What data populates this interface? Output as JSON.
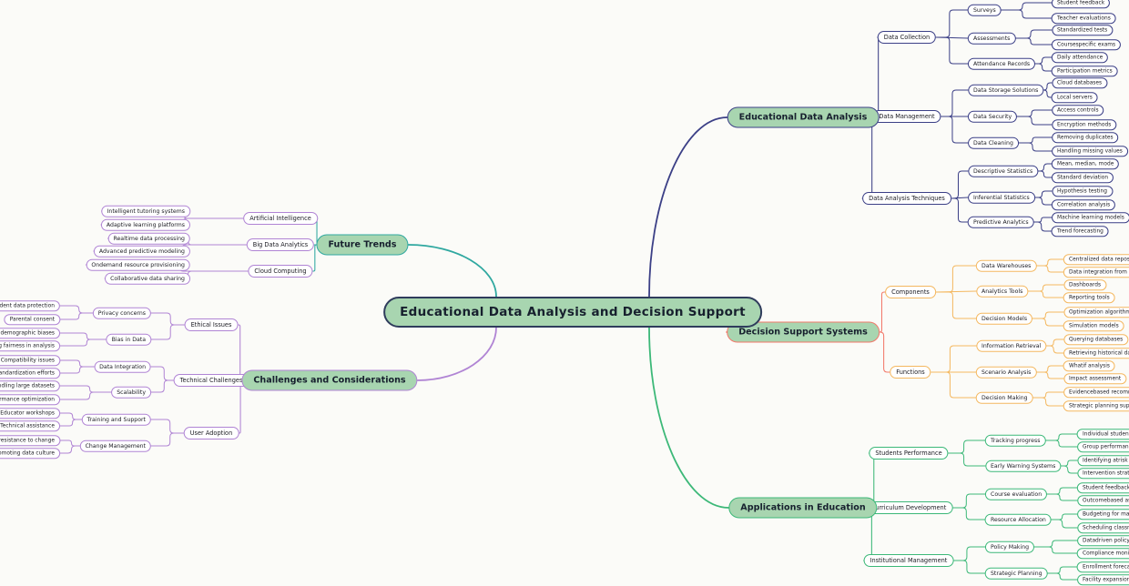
{
  "title": "Educational Data Analysis and Decision Support",
  "root": {
    "label": "Educational Data Analysis and Decision Support",
    "fill": "#a8d5b0",
    "stroke": "#2f3c5c"
  },
  "palette": {
    "background": "#fbfbf8",
    "navy": "#3b3f86",
    "teal": "#2fa8a0",
    "purple": "#b084d4",
    "coral": "#f2786a",
    "green": "#3cb878",
    "orange": "#f4b860",
    "level1_fill": "#a8d5b0"
  },
  "branches": [
    {
      "id": "educational-data-analysis",
      "label": "Educational Data Analysis",
      "color": "#3b3f86",
      "side": "right",
      "children": [
        {
          "label": "Data Collection",
          "children": [
            {
              "label": "Surveys",
              "children": [
                "Student feedback",
                "Teacher evaluations"
              ]
            },
            {
              "label": "Assessments",
              "children": [
                "Standardized tests",
                "Coursespecific exams"
              ]
            },
            {
              "label": "Attendance Records",
              "children": [
                "Daily attendance",
                "Participation metrics"
              ]
            }
          ]
        },
        {
          "label": "Data Management",
          "children": [
            {
              "label": "Data Storage Solutions",
              "children": [
                "Cloud databases",
                "Local servers"
              ]
            },
            {
              "label": "Data Security",
              "children": [
                "Access controls",
                "Encryption methods"
              ]
            },
            {
              "label": "Data Cleaning",
              "children": [
                "Removing duplicates",
                "Handling missing values"
              ]
            }
          ]
        },
        {
          "label": "Data Analysis Techniques",
          "children": [
            {
              "label": "Descriptive Statistics",
              "children": [
                "Mean, median, mode",
                "Standard deviation"
              ]
            },
            {
              "label": "Inferential Statistics",
              "children": [
                "Hypothesis testing",
                "Correlation analysis"
              ]
            },
            {
              "label": "Predictive Analytics",
              "children": [
                "Machine learning models",
                "Trend forecasting"
              ]
            }
          ]
        }
      ]
    },
    {
      "id": "decision-support-systems",
      "label": "Decision Support Systems",
      "color": "#f2786a",
      "subcolor": "#f4b860",
      "side": "right",
      "children": [
        {
          "label": "Components",
          "children": [
            {
              "label": "Data Warehouses",
              "children": [
                "Centralized data repository",
                "Data integration from multiple sources"
              ]
            },
            {
              "label": "Analytics Tools",
              "children": [
                "Dashboards",
                "Reporting tools"
              ]
            },
            {
              "label": "Decision Models",
              "children": [
                "Optimization algorithms",
                "Simulation models"
              ]
            }
          ]
        },
        {
          "label": "Functions",
          "children": [
            {
              "label": "Information Retrieval",
              "children": [
                "Querying databases",
                "Retrieving historical data"
              ]
            },
            {
              "label": "Scenario Analysis",
              "children": [
                "Whatif analysis",
                "Impact assessment"
              ]
            },
            {
              "label": "Decision Making",
              "children": [
                "Evidencebased recommendations",
                "Strategic planning support"
              ]
            }
          ]
        }
      ]
    },
    {
      "id": "applications-in-education",
      "label": "Applications in Education",
      "color": "#3cb878",
      "side": "right",
      "children": [
        {
          "label": "Students Performance",
          "children": [
            {
              "label": "Tracking progress",
              "children": [
                "Individual student analysis",
                "Group performance comparison"
              ]
            },
            {
              "label": "Early Warning Systems",
              "children": [
                "Identifying atrisk students",
                "Intervention strategies"
              ]
            }
          ]
        },
        {
          "label": "Curriculum Development",
          "children": [
            {
              "label": "Course evaluation",
              "children": [
                "Student feedback integration",
                "Outcomebased assessment"
              ]
            },
            {
              "label": "Resource Allocation",
              "children": [
                "Budgeting for materials",
                "Scheduling classrooms"
              ]
            }
          ]
        },
        {
          "label": "Institutional Management",
          "children": [
            {
              "label": "Policy Making",
              "children": [
                "Datadriven policy formulation",
                "Compliance monitoring"
              ]
            },
            {
              "label": "Strategic Planning",
              "children": [
                "Enrollment forecasting",
                "Facility expansion planning"
              ]
            }
          ]
        }
      ]
    },
    {
      "id": "challenges-and-considerations",
      "label": "Challenges and Considerations",
      "color": "#b084d4",
      "side": "left",
      "children": [
        {
          "label": "Ethical Issues",
          "children": [
            {
              "label": "Privacy concerns",
              "children": [
                "Student data protection",
                "Parental consent"
              ]
            },
            {
              "label": "Bias in Data",
              "children": [
                "Addressing demographic biases",
                "Ensuring fairness in analysis"
              ]
            }
          ]
        },
        {
          "label": "Technical Challenges",
          "children": [
            {
              "label": "Data Integration",
              "children": [
                "Compatibility issues",
                "Standardization efforts"
              ]
            },
            {
              "label": "Scalability",
              "children": [
                "Handling large datasets",
                "Performance optimization"
              ]
            }
          ]
        },
        {
          "label": "User Adoption",
          "children": [
            {
              "label": "Training and Support",
              "children": [
                "Educator workshops",
                "Technical assistance"
              ]
            },
            {
              "label": "Change Management",
              "children": [
                "Overcoming resistance to change",
                "Promoting data culture"
              ]
            }
          ]
        }
      ]
    },
    {
      "id": "future-trends",
      "label": "Future Trends",
      "color": "#2fa8a0",
      "subcolor": "#b084d4",
      "side": "left",
      "children": [
        {
          "label": "Artificial Intelligence",
          "children": [
            "Intelligent tutoring systems",
            "Adaptive learning platforms"
          ]
        },
        {
          "label": "Big Data Analytics",
          "children": [
            "Realtime data processing",
            "Advanced predictive modeling"
          ]
        },
        {
          "label": "Cloud Computing",
          "children": [
            "Ondemand resource provisioning",
            "Collaborative data sharing"
          ]
        }
      ]
    }
  ]
}
